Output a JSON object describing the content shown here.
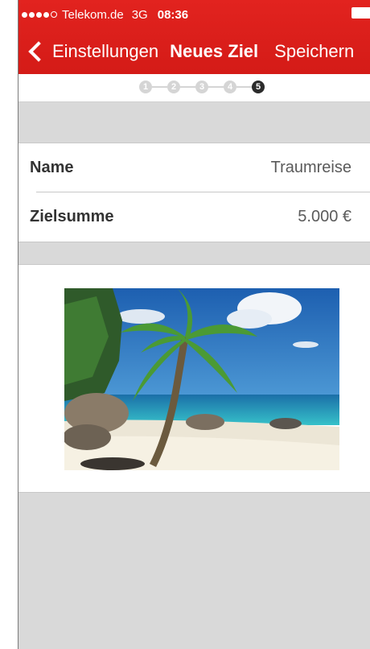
{
  "status_bar": {
    "carrier": "Telekom.de",
    "network": "3G",
    "time": "08:36",
    "signal_bars_filled": 4,
    "signal_bars_total": 5
  },
  "nav": {
    "back_label": "Einstellungen",
    "title": "Neues Ziel",
    "save_label": "Speichern"
  },
  "steps": {
    "items": [
      "1",
      "2",
      "3",
      "4",
      "5"
    ],
    "active": 5
  },
  "form": {
    "rows": [
      {
        "label": "Name",
        "value": "Traumreise"
      },
      {
        "label": "Zielsumme",
        "value": "5.000 €"
      }
    ]
  },
  "goal_image": {
    "icon": "beach-palm-photo"
  },
  "colors": {
    "accent": "#d91d1a",
    "background": "#d9d9d9",
    "step_active": "#2b2b2b",
    "step_inactive": "#d5d5d5"
  }
}
